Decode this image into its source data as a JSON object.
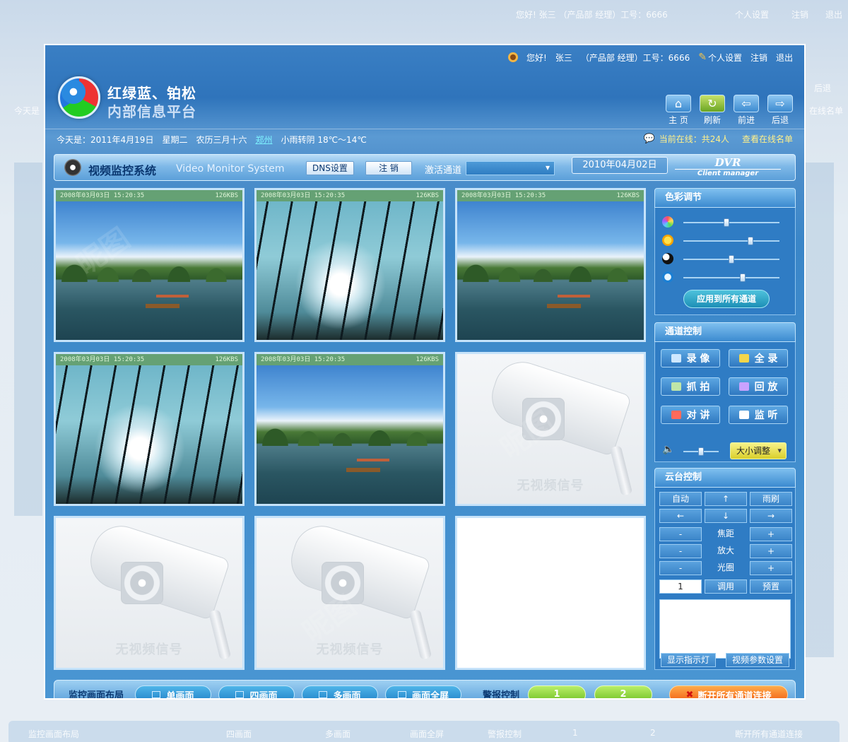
{
  "background": {
    "user_greeting": "您好!  张三  （产品部  经理）工号：6666",
    "settings": "个人设置",
    "logout": "注销",
    "exit": "退出",
    "back": "后退",
    "online_list": "在线名单",
    "today": "今天是",
    "bottom_layout": "监控画面布局",
    "bottom_four": "四画面",
    "bottom_multi": "多画面",
    "bottom_full": "画面全屏",
    "bottom_alarm": "警报控制",
    "bottom_alarm_1": "1",
    "bottom_alarm_2": "2",
    "bottom_disconnect": "断开所有通道连接"
  },
  "userbar": {
    "greeting": "您好!",
    "name": "张三",
    "dept": "（产品部  经理）工号：6666",
    "settings": "个人设置",
    "logout": "注销",
    "exit": "退出"
  },
  "brand": {
    "line1": "红绿蓝、铂松",
    "line2": "内部信息平台"
  },
  "nav": [
    {
      "label": "主 页",
      "icon": "home-icon",
      "glyph": "⌂"
    },
    {
      "label": "刷新",
      "icon": "refresh-icon",
      "glyph": "↻"
    },
    {
      "label": "前进",
      "icon": "forward-icon",
      "glyph": "⇦"
    },
    {
      "label": "后退",
      "icon": "back-icon",
      "glyph": "⇨"
    }
  ],
  "info": {
    "date": "今天是：2011年4月19日",
    "weekday": "星期二",
    "lunar": "农历三月十六",
    "city": "郑州",
    "weather": "小雨转阴  18℃～14℃",
    "online": "当前在线：共24人",
    "online_list": "查看在线名单"
  },
  "system": {
    "title": "视频监控系统",
    "subtitle": "Video Monitor System",
    "dns_button": "DNS设置",
    "logout_button": "注 销",
    "channel_label": "激活通道",
    "channel_value": "",
    "date": "2010年04月02日",
    "dvr": "DVR",
    "client": "Client manager"
  },
  "cells": [
    {
      "type": "live",
      "scene": "lake",
      "timestamp": "2008年03月03日  15:20:35",
      "rate": "126KBS"
    },
    {
      "type": "live",
      "scene": "forest",
      "timestamp": "2008年03月03日  15:20:35",
      "rate": "126KBS"
    },
    {
      "type": "live",
      "scene": "lake",
      "timestamp": "2008年03月03日  15:20:35",
      "rate": "126KBS"
    },
    {
      "type": "live",
      "scene": "forest",
      "timestamp": "2008年03月03日  15:20:35",
      "rate": "126KBS"
    },
    {
      "type": "live",
      "scene": "lake",
      "timestamp": "2008年03月03日  15:20:35",
      "rate": "126KBS"
    },
    {
      "type": "nosignal",
      "text": "无视频信号"
    },
    {
      "type": "nosignal",
      "text": "无视频信号"
    },
    {
      "type": "nosignal",
      "text": "无视频信号"
    },
    {
      "type": "empty"
    }
  ],
  "color_panel": {
    "title": "色彩调节",
    "sliders": [
      {
        "name": "hue",
        "icon": "hue-icon",
        "value": 0.45
      },
      {
        "name": "brightness",
        "icon": "sun-icon",
        "value": 0.7
      },
      {
        "name": "contrast",
        "icon": "contrast-icon",
        "value": 0.5
      },
      {
        "name": "saturation",
        "icon": "saturation-icon",
        "value": 0.62
      }
    ],
    "apply": "应用到所有通道"
  },
  "channel_panel": {
    "title": "通道控制",
    "buttons": [
      {
        "label": "录 像",
        "icon": "record-icon"
      },
      {
        "label": "全 录",
        "icon": "record-all-icon"
      },
      {
        "label": "抓 拍",
        "icon": "snapshot-icon"
      },
      {
        "label": "回 放",
        "icon": "playback-icon"
      },
      {
        "label": "对 讲",
        "icon": "intercom-icon"
      },
      {
        "label": "监 听",
        "icon": "headphones-icon"
      }
    ],
    "volume": 0.5,
    "size_button": "大小调整"
  },
  "ptz_panel": {
    "title": "云台控制",
    "auto": "自动",
    "up": "↑",
    "wiper": "雨刷",
    "left": "←",
    "down": "↓",
    "right": "→",
    "focus": "焦距",
    "zoom": "放大",
    "iris": "光圈",
    "minus": "-",
    "plus": "+",
    "preset_value": "1",
    "call": "调用",
    "preset": "预置",
    "indicator": "显示指示灯",
    "video_params": "视频参数设置"
  },
  "bottom": {
    "layout_label": "监控画面布局",
    "single": "单画面",
    "four": "四画面",
    "multi": "多画面",
    "fullscreen": "画面全屏",
    "alarm_label": "警报控制",
    "alarm_1": "1",
    "alarm_2": "2",
    "disconnect": "断开所有通道连接"
  }
}
